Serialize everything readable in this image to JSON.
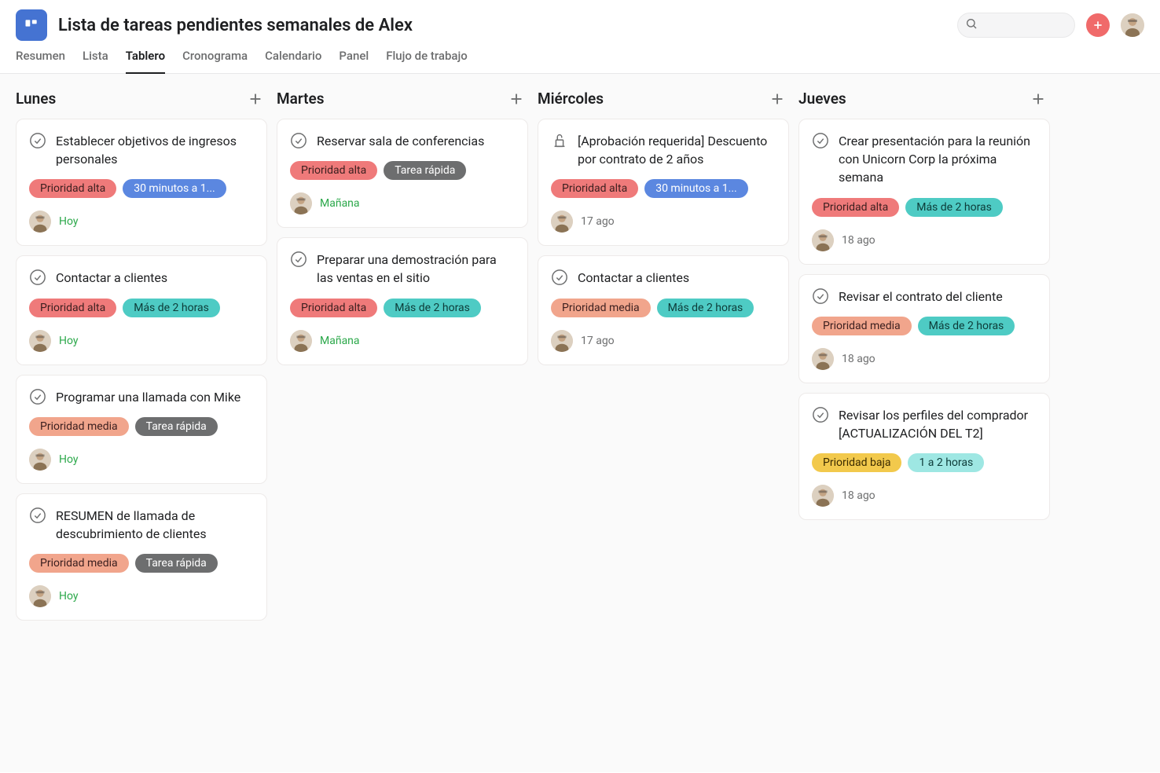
{
  "project": {
    "title": "Lista de tareas pendientes semanales de Alex"
  },
  "tabs": [
    {
      "label": "Resumen"
    },
    {
      "label": "Lista"
    },
    {
      "label": "Tablero",
      "active": true
    },
    {
      "label": "Cronograma"
    },
    {
      "label": "Calendario"
    },
    {
      "label": "Panel"
    },
    {
      "label": "Flujo de trabajo"
    }
  ],
  "search": {
    "placeholder": ""
  },
  "tag_styles": {
    "priority_high": {
      "label": "Prioridad alta",
      "bg": "#ef7a7a",
      "fg": "#3b1f1f"
    },
    "priority_medium": {
      "label": "Prioridad media",
      "bg": "#f1a58c",
      "fg": "#3b1f1f"
    },
    "priority_low": {
      "label": "Prioridad baja",
      "bg": "#f2c94c",
      "fg": "#3b2b00"
    },
    "dur_30_1h": {
      "label": "30 minutos a 1...",
      "bg": "#5b87e0",
      "fg": "#ffffff"
    },
    "dur_quick": {
      "label": "Tarea rápida",
      "bg": "#6d6e6f",
      "fg": "#ffffff"
    },
    "dur_2h_plus": {
      "label": "Más de 2 horas",
      "bg": "#4ecbc4",
      "fg": "#0d3b38"
    },
    "dur_1_2h": {
      "label": "1 a 2 horas",
      "bg": "#9ee7e3",
      "fg": "#0d3b38"
    }
  },
  "columns": [
    {
      "title": "Lunes",
      "cards": [
        {
          "icon": "check",
          "title": "Establecer objetivos de ingresos personales",
          "tags": [
            "priority_high",
            "dur_30_1h"
          ],
          "due": "Hoy",
          "due_soon": true
        },
        {
          "icon": "check",
          "title": "Contactar a clientes",
          "tags": [
            "priority_high",
            "dur_2h_plus"
          ],
          "due": "Hoy",
          "due_soon": true
        },
        {
          "icon": "check",
          "title": "Programar una llamada con Mike",
          "tags": [
            "priority_medium",
            "dur_quick"
          ],
          "due": "Hoy",
          "due_soon": true
        },
        {
          "icon": "check",
          "title": "RESUMEN de llamada de descubrimiento de clientes",
          "tags": [
            "priority_medium",
            "dur_quick"
          ],
          "due": "Hoy",
          "due_soon": true
        }
      ]
    },
    {
      "title": "Martes",
      "cards": [
        {
          "icon": "check",
          "title": "Reservar sala de conferencias",
          "tags": [
            "priority_high",
            "dur_quick"
          ],
          "due": "Mañana",
          "due_soon": true
        },
        {
          "icon": "check",
          "title": "Preparar una demostración para las ventas en el sitio",
          "tags": [
            "priority_high",
            "dur_2h_plus"
          ],
          "due": "Mañana",
          "due_soon": true
        }
      ]
    },
    {
      "title": "Miércoles",
      "cards": [
        {
          "icon": "approval",
          "title": "[Aprobación requerida] Descuento por contrato de 2 años",
          "tags": [
            "priority_high",
            "dur_30_1h"
          ],
          "due": "17 ago",
          "due_soon": false
        },
        {
          "icon": "check",
          "title": "Contactar a clientes",
          "tags": [
            "priority_medium",
            "dur_2h_plus"
          ],
          "due": "17 ago",
          "due_soon": false
        }
      ]
    },
    {
      "title": "Jueves",
      "cards": [
        {
          "icon": "check",
          "title": "Crear presentación para la reunión con Unicorn Corp la próxima semana",
          "tags": [
            "priority_high",
            "dur_2h_plus"
          ],
          "due": "18 ago",
          "due_soon": false
        },
        {
          "icon": "check",
          "title": "Revisar el contrato del cliente",
          "tags": [
            "priority_medium",
            "dur_2h_plus"
          ],
          "due": "18 ago",
          "due_soon": false
        },
        {
          "icon": "check",
          "title": "Revisar los perfiles del comprador [ACTUALIZACIÓN DEL T2]",
          "tags": [
            "priority_low",
            "dur_1_2h"
          ],
          "due": "18 ago",
          "due_soon": false
        }
      ]
    }
  ]
}
